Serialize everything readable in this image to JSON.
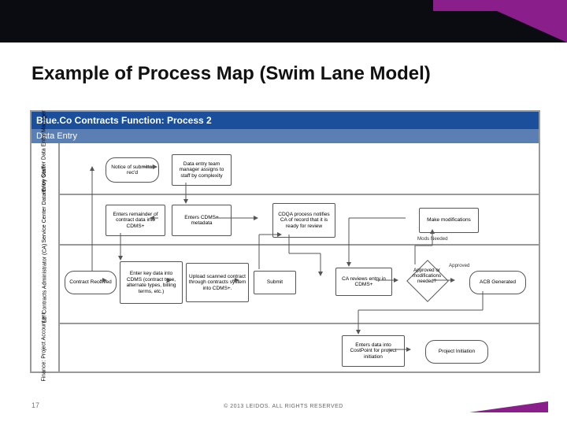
{
  "slide": {
    "title": "Example of Process Map (Swim Lane Model)",
    "page_number": "17",
    "copyright": "© 2013 LEIDOS. ALL RIGHTS RESERVED"
  },
  "header": {
    "title": "Blue.Co Contracts Function:  Process 2",
    "subtitle": "Data Entry"
  },
  "lanes": {
    "l1a": "L1: Shared\nService Center\nData Entry\nManager",
    "l1b": "L1: Shared\nService Center\nData Entry Staff",
    "l2": "L2: Contracts\nAdministrator\n(CA)",
    "fin": "Finance: Project\nAccountant"
  },
  "boxes": {
    "notice": "Notice of submittal rec'd",
    "assign": "Data entry team manager assigns to staff by complexity",
    "remainder": "Enters remainder of contract data into CDMS+",
    "metadata": "Enters CDMS+ metadata",
    "cdqa": "CDQA process notifies CA of record that it is ready for review",
    "makemods": "Make modifications",
    "contract_recv": "Contract Received",
    "keydata": "Enter key data into CDMS (contract type, alternate types, billing terms, etc.)",
    "upload": "Upload scanned contract through contracts system into CDMS+.",
    "submit": "Submit",
    "careview": "CA reviews entry in CDMS+",
    "approve_q": "Approved or modifications needed?",
    "acb": "ACB Generated",
    "costpoint": "Enters data into CostPoint for project initiation",
    "projinit": "Project Initiation"
  },
  "edge_labels": {
    "mods": "Mods Needed",
    "approved": "Approved"
  }
}
